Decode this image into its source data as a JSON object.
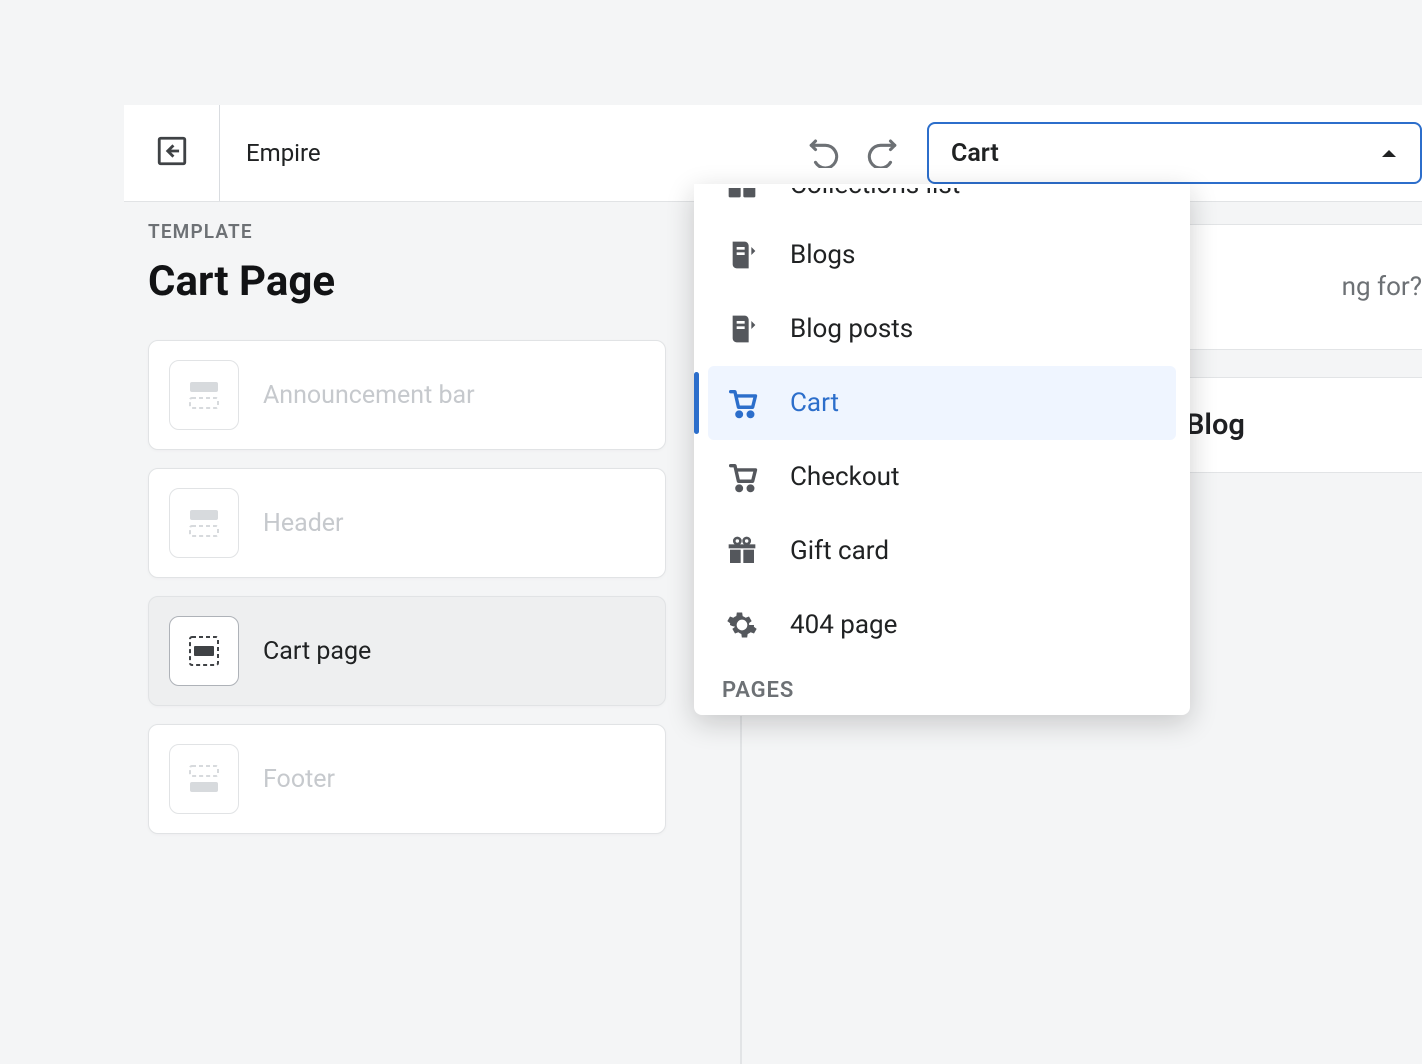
{
  "toolbar": {
    "theme_name": "Empire",
    "page_select_label": "Cart"
  },
  "sidebar": {
    "kicker": "TEMPLATE",
    "title": "Cart Page",
    "sections": [
      {
        "label": "Announcement bar",
        "icon": "section-top",
        "active": false
      },
      {
        "label": "Header",
        "icon": "section-top",
        "active": false
      },
      {
        "label": "Cart page",
        "icon": "section-middle",
        "active": true
      },
      {
        "label": "Footer",
        "icon": "section-bottom",
        "active": false
      }
    ]
  },
  "dropdown": {
    "items": [
      {
        "label": "Collections list",
        "icon": "grid",
        "partial": true
      },
      {
        "label": "Blogs",
        "icon": "blog",
        "partial": false
      },
      {
        "label": "Blog posts",
        "icon": "blog",
        "partial": false
      },
      {
        "label": "Cart",
        "icon": "cart",
        "partial": false,
        "selected": true
      },
      {
        "label": "Checkout",
        "icon": "cart",
        "partial": false
      },
      {
        "label": "Gift card",
        "icon": "gift",
        "partial": false
      },
      {
        "label": "404 page",
        "icon": "gear",
        "partial": false
      }
    ],
    "heading": "PAGES"
  },
  "preview": {
    "search_fragment": "ng for?",
    "nav_fragment": "Blog"
  }
}
